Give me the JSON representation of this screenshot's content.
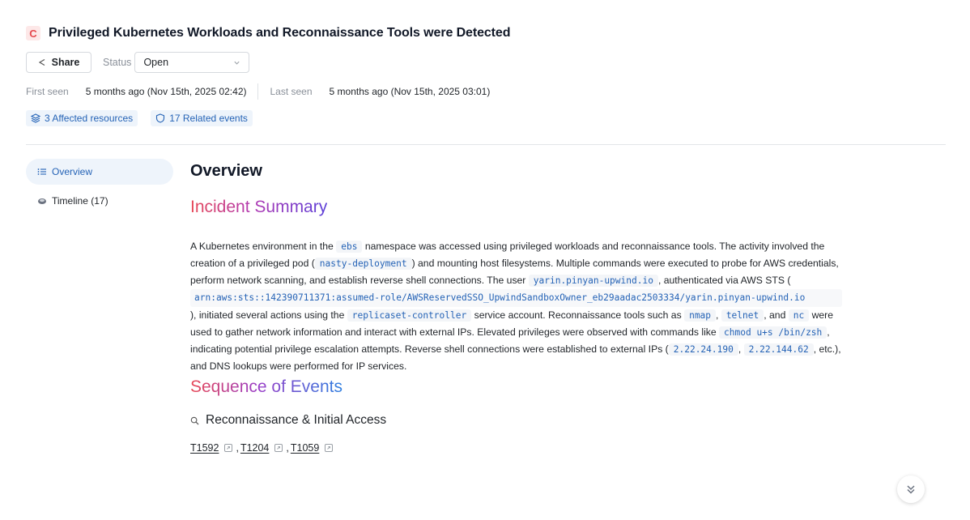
{
  "incident": {
    "severity_letter": "C",
    "title": "Privileged Kubernetes Workloads and Reconnaissance Tools were Detected",
    "share_label": "Share",
    "status_label": "Status",
    "status_value": "Open",
    "first_seen_label": "First seen",
    "first_seen_value": "5 months ago (Nov 15th, 2025 02:42)",
    "last_seen_label": "Last seen",
    "last_seen_value": "5 months ago (Nov 15th, 2025 03:01)",
    "affected_resources": "3 Affected resources",
    "related_events": "17 Related events"
  },
  "sidebar": {
    "items": [
      {
        "label": "Overview",
        "icon": "list-icon",
        "active": true
      },
      {
        "label": "Timeline (17)",
        "icon": "timeline-icon",
        "active": false
      }
    ]
  },
  "main": {
    "overview_heading": "Overview",
    "summary_heading": "Incident Summary",
    "summary": {
      "t1": "A Kubernetes environment in the ",
      "c1": "ebs",
      "t2": " namespace was accessed using privileged workloads and reconnaissance tools. The activity involved the creation of a privileged pod (",
      "c2": "nasty-deployment",
      "t3": ") and mounting host filesystems. Multiple commands were executed to probe for AWS credentials, perform network scanning, and establish reverse shell connections. The user ",
      "c3": "yarin.pinyan-upwind.io",
      "t4": ", authenticated via AWS STS (",
      "c4": "arn:aws:sts::142390711371:assumed-role/AWSReservedSSO_UpwindSandboxOwner_eb29aadac2503334/yarin.pinyan-upwind.io",
      "t5": "), initiated several actions using the ",
      "c5": "replicaset-controller",
      "t6": " service account. Reconnaissance tools such as ",
      "c6": "nmap",
      "t7": ", ",
      "c7": "telnet",
      "t8": ", and ",
      "c8": "nc",
      "t9": " were used to gather network information and interact with external IPs. Elevated privileges were observed with commands like ",
      "c9": "chmod u+s /bin/zsh",
      "t10": ", indicating potential privilege escalation attempts. Reverse shell connections were established to external IPs (",
      "c10": "2.22.24.190",
      "t11": ", ",
      "c11": "2.22.144.62",
      "t12": ", etc.), and DNS lookups were performed for IP services."
    },
    "sequence_heading": "Sequence of Events",
    "phase_heading": "Reconnaissance & Initial Access",
    "techniques": [
      "T1592",
      "T1204",
      "T1059"
    ],
    "separator": ","
  },
  "colors": {
    "accent": "#2563b6",
    "severity": "#e5484d",
    "chip_bg": "#eef4fb"
  }
}
